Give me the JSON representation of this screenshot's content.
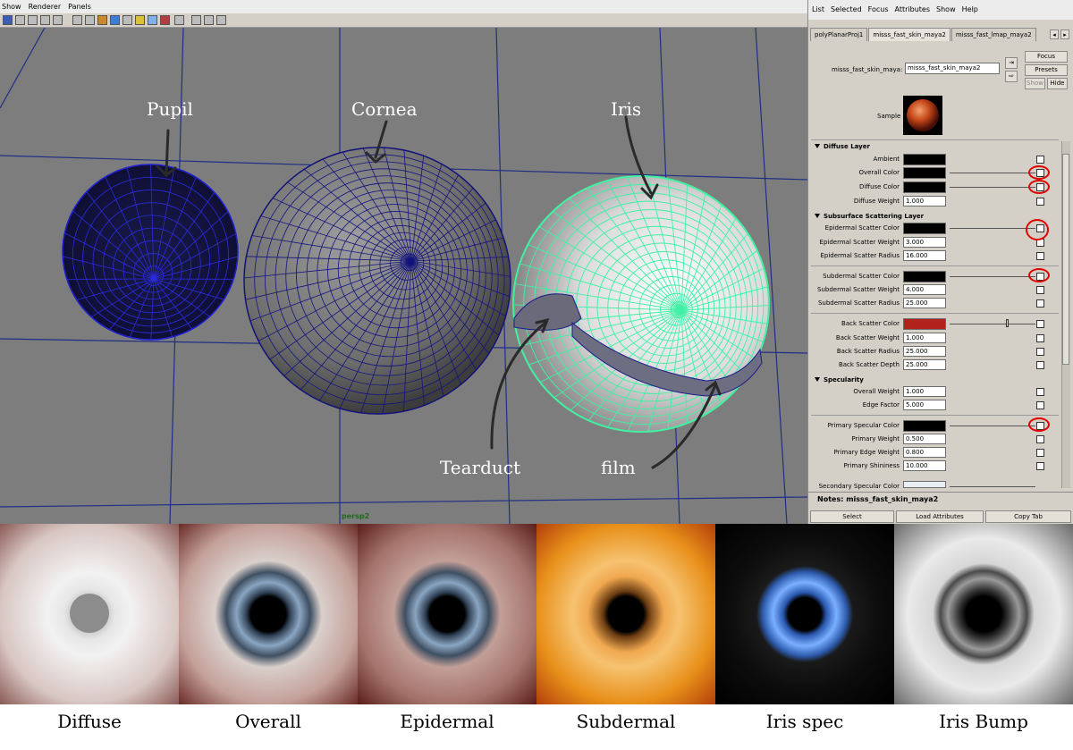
{
  "menubar": [
    "Show",
    "Renderer",
    "Panels"
  ],
  "viewport": {
    "camera": "persp2",
    "labels": [
      "Pupil",
      "Cornea",
      "Iris",
      "Tearduct",
      "film"
    ]
  },
  "attribute_editor": {
    "menu": [
      "List",
      "Selected",
      "Focus",
      "Attributes",
      "Show",
      "Help"
    ],
    "tabs": [
      "polyPlanarProj1",
      "misss_fast_skin_maya2",
      "misss_fast_lmap_maya2"
    ],
    "node_type_label": "misss_fast_skin_maya:",
    "node_name": "misss_fast_skin_maya2",
    "buttons": {
      "focus": "Focus",
      "presets": "Presets",
      "show": "Show",
      "hide": "Hide"
    },
    "sample_label": "Sample",
    "sections": {
      "diffuse": "Diffuse Layer",
      "sss": "Subsurface Scattering Layer",
      "spec": "Specularity"
    },
    "attrs": {
      "ambient": "Ambient",
      "overall_color": "Overall Color",
      "diffuse_color": "Diffuse Color",
      "diffuse_weight": "Diffuse Weight",
      "diffuse_weight_val": "1.000",
      "epi_color": "Epidermal Scatter Color",
      "epi_weight": "Epidermal Scatter Weight",
      "epi_weight_val": "3.000",
      "epi_radius": "Epidermal Scatter Radius",
      "epi_radius_val": "16.000",
      "sub_color": "Subdermal Scatter Color",
      "sub_weight": "Subdermal Scatter Weight",
      "sub_weight_val": "4.000",
      "sub_radius": "Subdermal Scatter Radius",
      "sub_radius_val": "25.000",
      "back_color": "Back Scatter Color",
      "back_weight": "Back Scatter Weight",
      "back_weight_val": "1.000",
      "back_radius": "Back Scatter Radius",
      "back_radius_val": "25.000",
      "back_depth": "Back Scatter Depth",
      "back_depth_val": "25.000",
      "overall_weight": "Overall Weight",
      "overall_weight_val": "1.000",
      "edge_factor": "Edge Factor",
      "edge_factor_val": "5.000",
      "prim_color": "Primary Specular Color",
      "prim_weight": "Primary Weight",
      "prim_weight_val": "0.500",
      "prim_edge": "Primary Edge Weight",
      "prim_edge_val": "0.800",
      "prim_shine": "Primary Shininess",
      "prim_shine_val": "10.000",
      "sec_color": "Secondary Specular Color"
    },
    "colors": {
      "black": "#000000",
      "back_scatter": "#b0221b",
      "secondary": "#e8eef4"
    },
    "notes_label": "Notes:",
    "notes_value": "misss_fast_skin_maya2",
    "bottom_buttons": [
      "Select",
      "Load Attributes",
      "Copy Tab"
    ]
  },
  "textures": [
    "Diffuse",
    "Overall",
    "Epidermal",
    "Subdermal",
    "Iris spec",
    "Iris Bump"
  ]
}
